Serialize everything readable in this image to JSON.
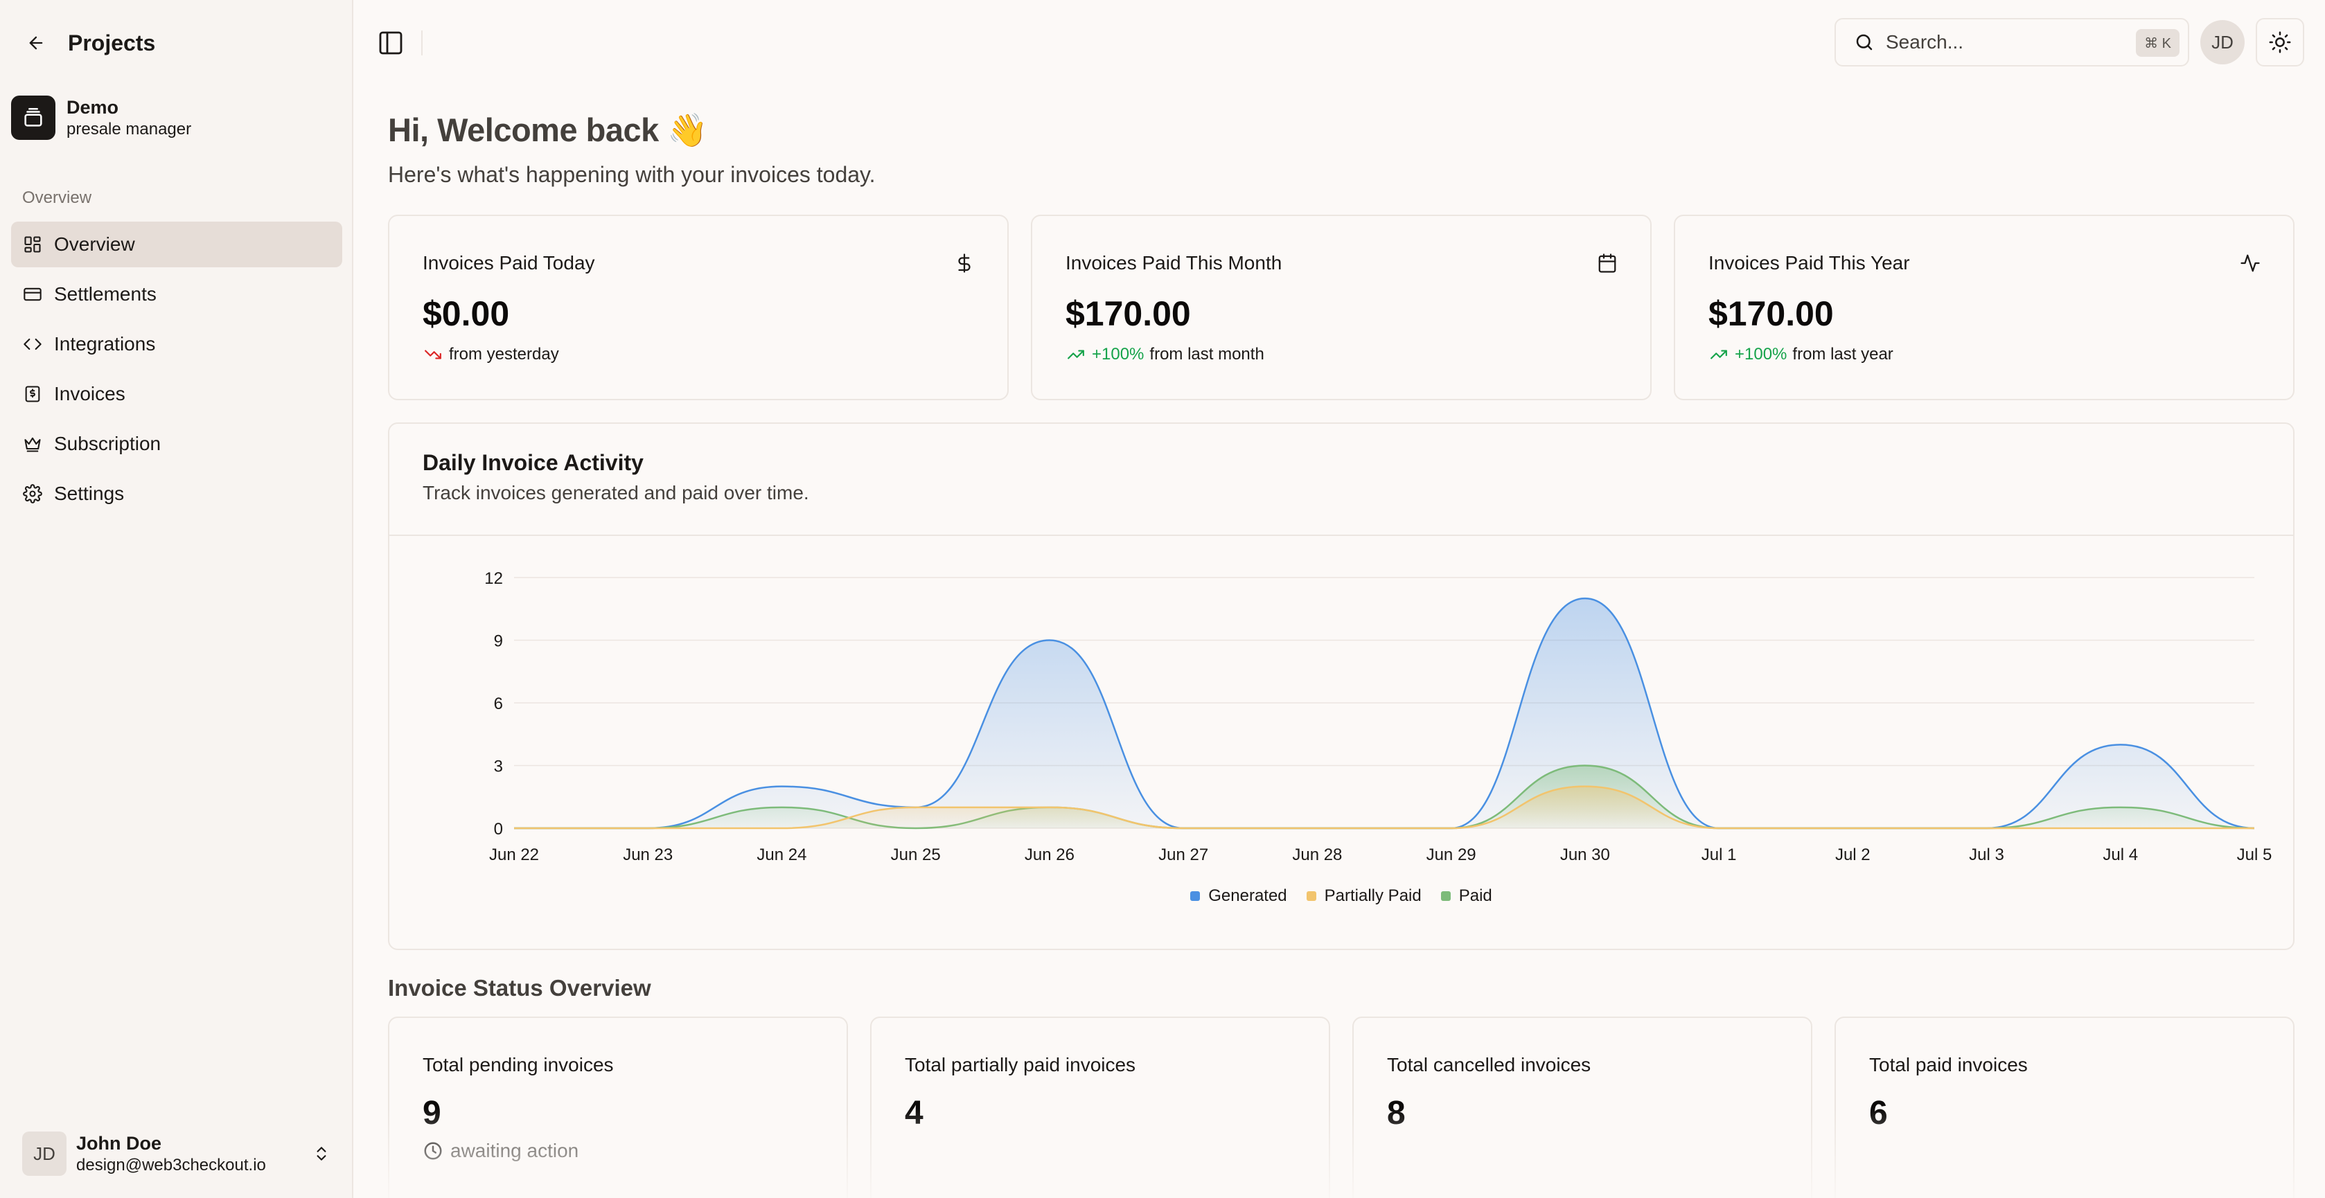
{
  "sidebar": {
    "title": "Projects",
    "org": {
      "name": "Demo",
      "role": "presale manager"
    },
    "section_label": "Overview",
    "items": [
      {
        "label": "Overview",
        "icon": "dashboard-icon",
        "active": true
      },
      {
        "label": "Settlements",
        "icon": "credit-card-icon",
        "active": false
      },
      {
        "label": "Integrations",
        "icon": "code-icon",
        "active": false
      },
      {
        "label": "Invoices",
        "icon": "invoice-icon",
        "active": false
      },
      {
        "label": "Subscription",
        "icon": "crown-icon",
        "active": false
      },
      {
        "label": "Settings",
        "icon": "gear-icon",
        "active": false
      }
    ],
    "user": {
      "initials": "JD",
      "name": "John Doe",
      "email": "design@web3checkout.io"
    }
  },
  "topbar": {
    "search_placeholder": "Search...",
    "shortcut": "⌘ K",
    "avatar_initials": "JD"
  },
  "greeting": {
    "title": "Hi, Welcome back 👋",
    "subtitle": "Here's what's happening with your invoices today."
  },
  "stats": [
    {
      "label": "Invoices Paid Today",
      "value": "$0.00",
      "change": "",
      "note": "from yesterday",
      "trend": "down",
      "icon": "dollar-icon"
    },
    {
      "label": "Invoices Paid This Month",
      "value": "$170.00",
      "change": "+100%",
      "note": "from last month",
      "trend": "up",
      "icon": "calendar-icon"
    },
    {
      "label": "Invoices Paid This Year",
      "value": "$170.00",
      "change": "+100%",
      "note": "from last year",
      "trend": "up",
      "icon": "activity-icon"
    }
  ],
  "activity": {
    "title": "Daily Invoice Activity",
    "subtitle": "Track invoices generated and paid over time."
  },
  "chart_data": {
    "type": "area",
    "x": [
      "Jun 22",
      "Jun 23",
      "Jun 24",
      "Jun 25",
      "Jun 26",
      "Jun 27",
      "Jun 28",
      "Jun 29",
      "Jun 30",
      "Jul 1",
      "Jul 2",
      "Jul 3",
      "Jul 4",
      "Jul 5"
    ],
    "series": [
      {
        "name": "Generated",
        "color": "#4a90e2",
        "values": [
          0,
          0,
          2,
          1,
          9,
          0,
          0,
          0,
          11,
          0,
          0,
          0,
          4,
          0
        ]
      },
      {
        "name": "Partially Paid",
        "color": "#f2c46d",
        "values": [
          0,
          0,
          0,
          1,
          1,
          0,
          0,
          0,
          2,
          0,
          0,
          0,
          0,
          0
        ]
      },
      {
        "name": "Paid",
        "color": "#7dbb7a",
        "values": [
          0,
          0,
          1,
          0,
          1,
          0,
          0,
          0,
          3,
          0,
          0,
          0,
          1,
          0
        ]
      }
    ],
    "yticks": [
      0,
      3,
      6,
      9,
      12
    ],
    "ylim": [
      0,
      12
    ],
    "grid": true,
    "legend": "bottom-center"
  },
  "status": {
    "title": "Invoice Status Overview",
    "cards": [
      {
        "label": "Total pending invoices",
        "value": "9",
        "note": "awaiting action"
      },
      {
        "label": "Total partially paid invoices",
        "value": "4",
        "note": ""
      },
      {
        "label": "Total cancelled invoices",
        "value": "8",
        "note": ""
      },
      {
        "label": "Total paid invoices",
        "value": "6",
        "note": ""
      }
    ]
  }
}
